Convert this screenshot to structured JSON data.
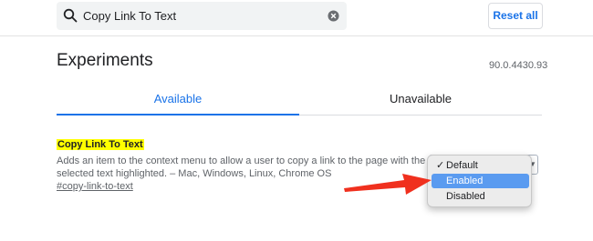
{
  "header": {
    "search": {
      "value": "Copy Link To Text",
      "icon": "search-icon",
      "clear_icon": "clear-icon"
    },
    "reset_label": "Reset all"
  },
  "page": {
    "title": "Experiments",
    "version": "90.0.4430.93"
  },
  "tabs": [
    {
      "label": "Available",
      "active": true
    },
    {
      "label": "Unavailable",
      "active": false
    }
  ],
  "experiment": {
    "title": "Copy Link To Text",
    "description": "Adds an item to the context menu to allow a user to copy a link to the page with the selected text highlighted. – Mac, Windows, Linux, Chrome OS",
    "link": "#copy-link-to-text",
    "dropdown": {
      "options": [
        {
          "label": "Default",
          "checked": true
        },
        {
          "label": "Enabled",
          "highlighted": true
        },
        {
          "label": "Disabled"
        }
      ],
      "check_glyph": "✓"
    }
  },
  "colors": {
    "accent": "#1a73e8",
    "highlight": "#ffff00",
    "menu_highlight": "#5a9bf0",
    "annotation_arrow": "#f0301e"
  }
}
